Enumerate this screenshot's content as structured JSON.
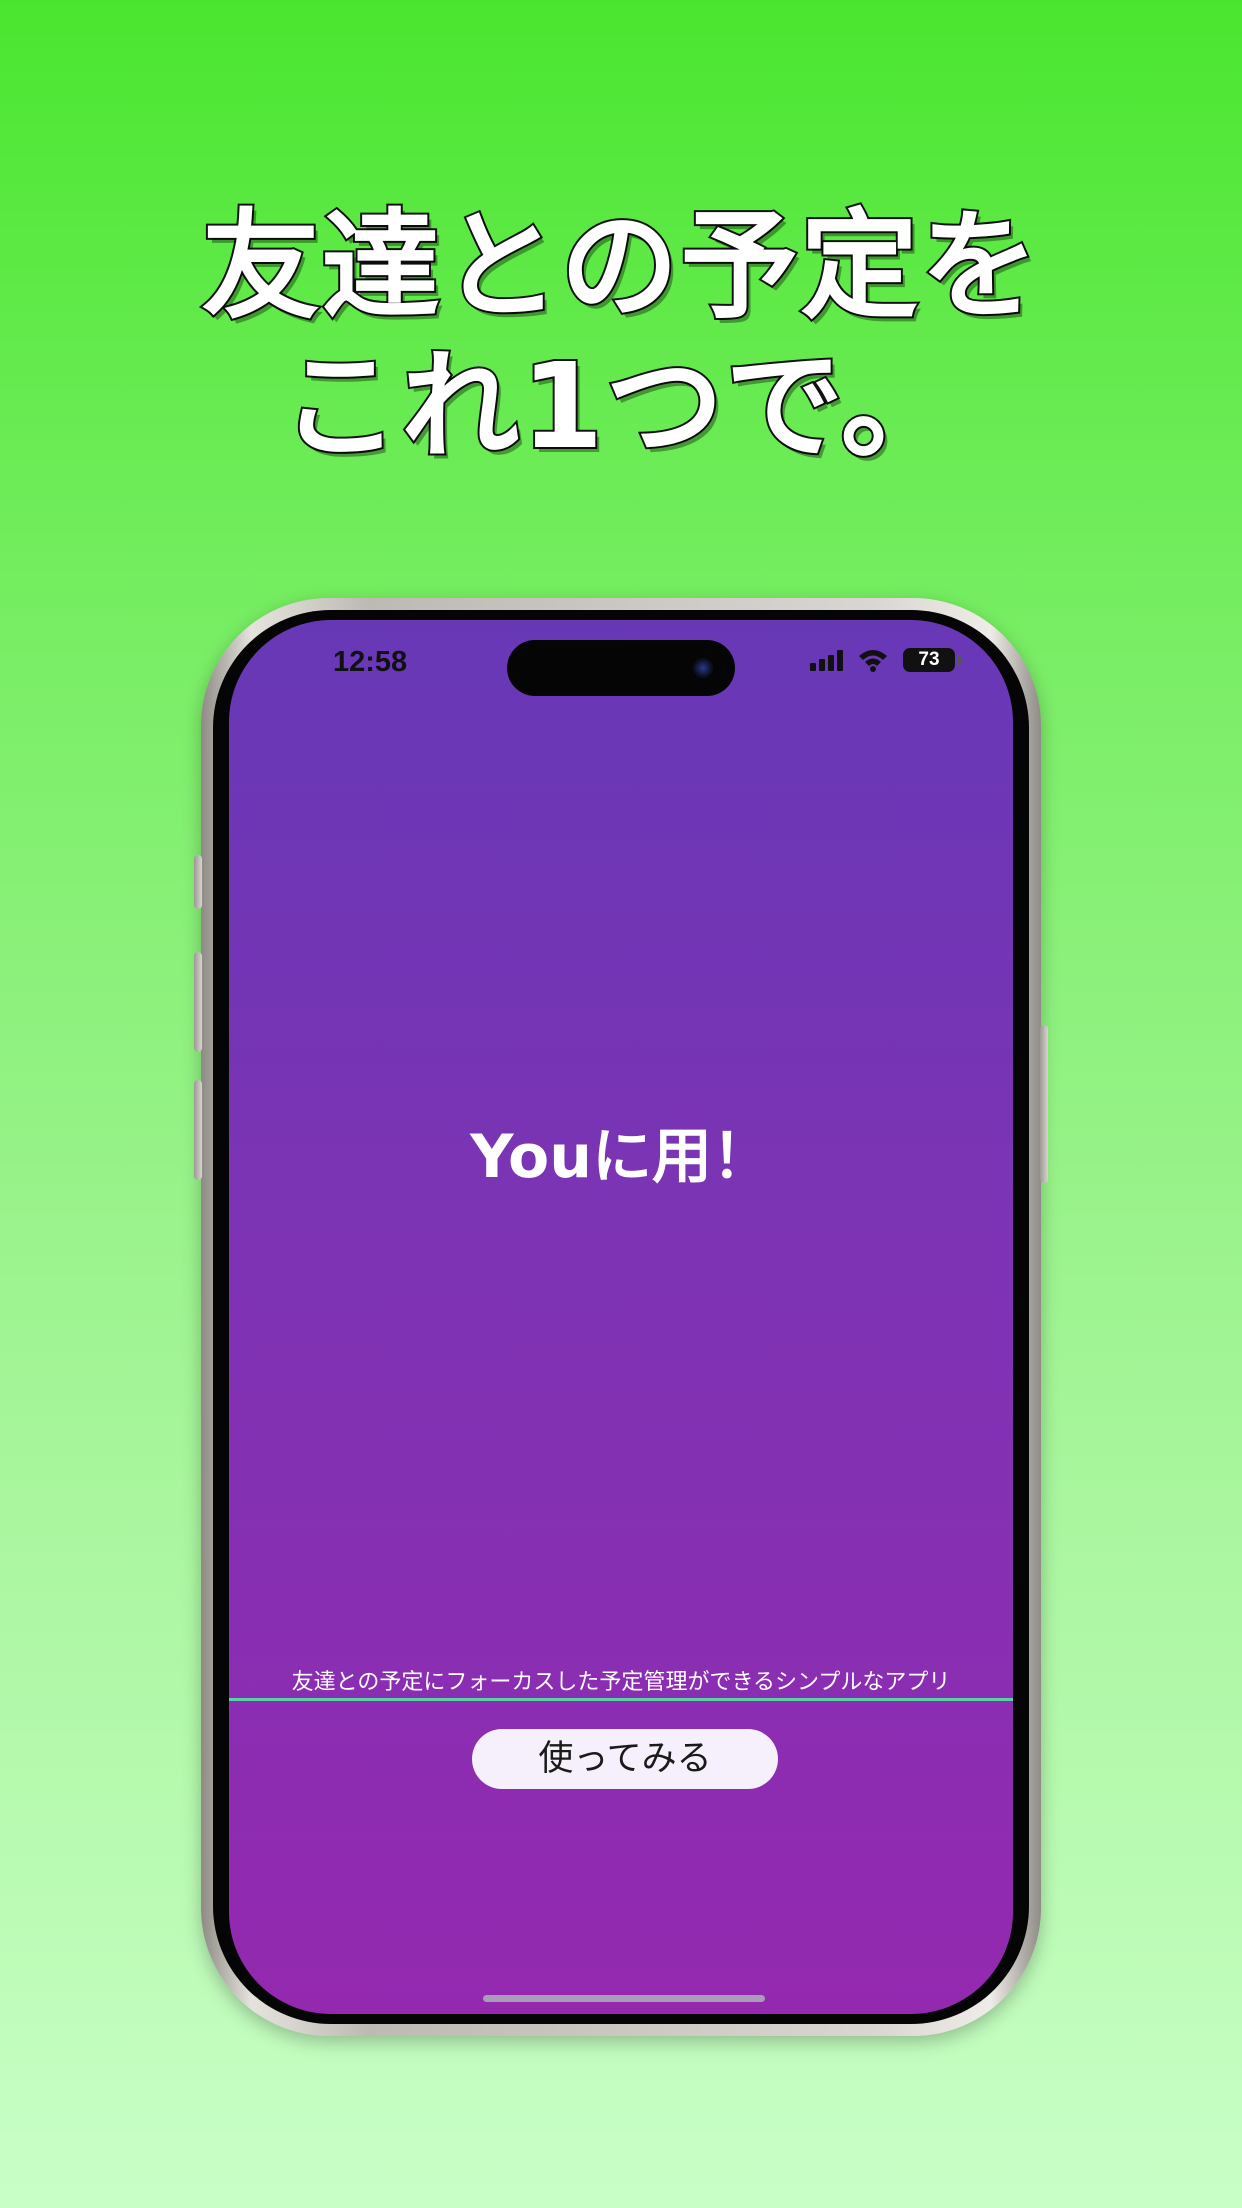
{
  "headline": {
    "line1": "友達との予定を",
    "line2": "これ1つで。"
  },
  "status_bar": {
    "time": "12:58",
    "battery": "73",
    "signal_icon": "cellular-signal-icon",
    "wifi_icon": "wifi-icon"
  },
  "app": {
    "title": "Youに用！",
    "description": "友達との予定にフォーカスした予定管理ができるシンプルなアプリ",
    "button_label": "使ってみる"
  },
  "colors": {
    "background_top": "#4ae62f",
    "background_bottom": "#c9ffc7",
    "screen_top": "#6738b6",
    "screen_bottom": "#9429b0"
  }
}
